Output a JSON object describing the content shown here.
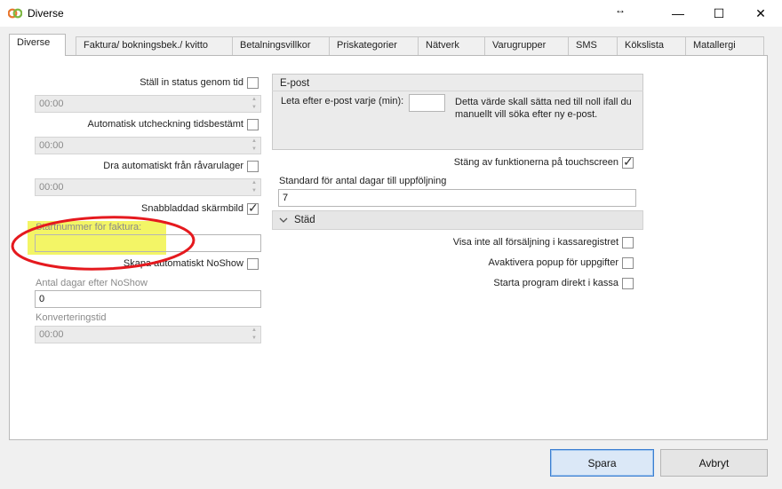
{
  "window": {
    "title": "Diverse",
    "resize_glyph": "↔",
    "minimize": "—",
    "maximize": "☐",
    "close": "✕"
  },
  "tabs": [
    {
      "label": "Diverse"
    },
    {
      "label": "Faktura/ bokningsbek./ kvitto"
    },
    {
      "label": "Betalningsvillkor"
    },
    {
      "label": "Priskategorier"
    },
    {
      "label": "Nätverk"
    },
    {
      "label": "Varugrupper"
    },
    {
      "label": "SMS"
    },
    {
      "label": "Kökslista"
    },
    {
      "label": "Matallergi"
    }
  ],
  "left": {
    "status_label": "Ställ in status genom tid",
    "status_time": "00:00",
    "checkout_label": "Automatisk utcheckning tidsbestämt",
    "checkout_time": "00:00",
    "raw_label": "Dra automatiskt från råvarulager",
    "raw_time": "00:00",
    "quickscreen_label": "Snabbladdad skärmbild",
    "invoice_start_label": "Startnummer för faktura:",
    "invoice_start_value": "",
    "noshow_label": "Skapa automatiskt NoShow",
    "noshow_days_label": "Antal dagar efter NoShow",
    "noshow_days_value": "0",
    "conversion_label": "Konverteringstid",
    "conversion_time": "00:00"
  },
  "right": {
    "email_group_title": "E-post",
    "email_poll_label": "Leta efter e-post varje (min):",
    "email_poll_value": "",
    "email_note": "Detta värde skall sätta ned till noll ifall du manuellt vill söka efter ny e-post.",
    "touch_label": "Stäng av funktionerna på touchscreen",
    "followup_label": "Standard för antal dagar till uppföljning",
    "followup_value": "7",
    "clean_section_title": "Städ",
    "hide_sales_label": "Visa inte all försäljning i kassaregistret",
    "popup_label": "Avaktivera popup för uppgifter",
    "start_direct_label": "Starta program direkt i kassa"
  },
  "state": {
    "status_checked": false,
    "checkout_checked": false,
    "raw_checked": false,
    "quickscreen_checked": true,
    "noshow_checked": false,
    "touch_checked": true,
    "hide_sales_checked": false,
    "popup_checked": false,
    "start_direct_checked": false
  },
  "buttons": {
    "save": "Spara",
    "cancel": "Avbryt"
  },
  "colors": {
    "highlight": "#f3f566",
    "annotation_red": "#e5191e",
    "accent": "#3c7fd1"
  },
  "icons": {
    "app": "app-logo-icon",
    "chevron": "chevron-down-icon"
  }
}
